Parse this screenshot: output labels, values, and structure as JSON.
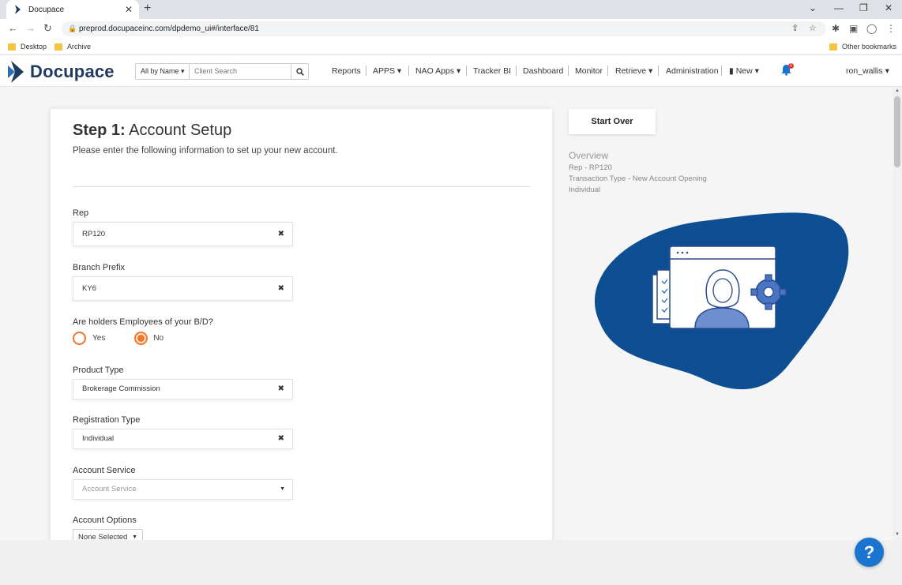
{
  "browser": {
    "tab_title": "Docupace",
    "url": "preprod.docupaceinc.com/dpdemo_ui#/interface/81",
    "bookmarks": [
      "Desktop",
      "Archive"
    ],
    "other_bookmarks": "Other bookmarks"
  },
  "header": {
    "logo_text": "Docupace",
    "search_mode": "All by Name",
    "search_placeholder": "Client Search",
    "nav": [
      "Reports",
      "APPS",
      "NAO Apps",
      "Tracker BI",
      "Dashboard",
      "Monitor",
      "Retrieve",
      "Administration",
      "New"
    ],
    "notification_count": "1",
    "user": "ron_wallis"
  },
  "form": {
    "step_label": "Step 1:",
    "step_title": "Account Setup",
    "subtitle": "Please enter the following information to set up your new account.",
    "rep_label": "Rep",
    "rep_value": "RP120",
    "branch_label": "Branch Prefix",
    "branch_value": "KY6",
    "employee_question": "Are holders Employees of your B/D?",
    "yes_label": "Yes",
    "no_label": "No",
    "selected_option": "No",
    "product_label": "Product Type",
    "product_value": "Brokerage Commission",
    "registration_label": "Registration Type",
    "registration_value": "Individual",
    "service_label": "Account Service",
    "service_placeholder": "Account Service",
    "options_label": "Account Options",
    "options_value": "None Selected"
  },
  "sidebar": {
    "start_over": "Start Over",
    "overview_title": "Overview",
    "overview_lines": [
      "Rep - RP120",
      "Transaction Type - New Account Opening",
      "Individual"
    ]
  },
  "colors": {
    "brand_navy": "#1f3b5f",
    "accent_orange": "#f0772b",
    "illustration_blue": "#0e4f94",
    "help_blue": "#1a75d1"
  }
}
